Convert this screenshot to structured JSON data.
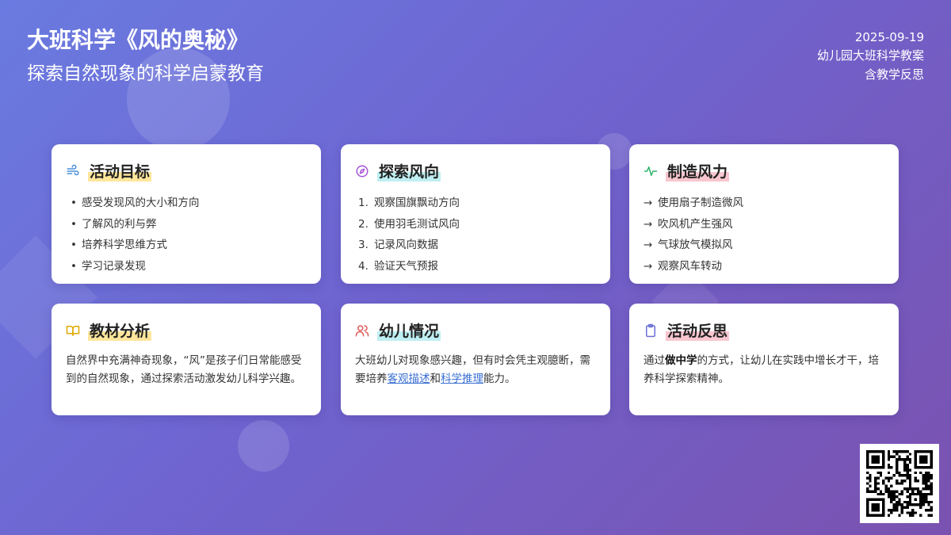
{
  "header": {
    "title": "大班科学《风的奥秘》",
    "subtitle": "探索自然现象的科学启蒙教育"
  },
  "meta": {
    "date": "2025-09-19",
    "type": "幼儿园大班科学教案",
    "note": "含教学反思"
  },
  "cards": {
    "goals": {
      "title": "活动目标",
      "icon": "wind-icon",
      "items": [
        "感受发现风的大小和方向",
        "了解风的利与弊",
        "培养科学思维方式",
        "学习记录发现"
      ]
    },
    "direction": {
      "title": "探索风向",
      "icon": "compass-icon",
      "items": [
        {
          "num": "1.",
          "text": "观察国旗飘动方向"
        },
        {
          "num": "2.",
          "text": "使用羽毛测试风向"
        },
        {
          "num": "3.",
          "text": "记录风向数据"
        },
        {
          "num": "4.",
          "text": "验证天气预报"
        }
      ]
    },
    "power": {
      "title": "制造风力",
      "icon": "activity-icon",
      "arrow": "→",
      "items": [
        "使用扇子制造微风",
        "吹风机产生强风",
        "气球放气模拟风",
        "观察风车转动"
      ]
    },
    "material": {
      "title": "教材分析",
      "icon": "book-icon",
      "text": "自然界中充满神奇现象，“风”是孩子们日常能感受到的自然现象，通过探索活动激发幼儿科学兴趣。"
    },
    "children": {
      "title": "幼儿情况",
      "icon": "users-icon",
      "text_a": "大班幼儿对现象感兴趣，但有时会凭主观臆断，需要培养",
      "link_a": "客观描述",
      "text_b": "和",
      "link_b": "科学推理",
      "text_c": "能力。"
    },
    "reflection": {
      "title": "活动反思",
      "icon": "clipboard-icon",
      "text_a": "通过",
      "bold": "做中学",
      "text_b": "的方式，让幼儿在实践中增长才干，培养科学探索精神。"
    }
  },
  "colors": {
    "wind_icon": "#4a8fd9",
    "compass_icon": "#a655d6",
    "activity_icon": "#2fb36b",
    "book_icon": "#e0a800",
    "users_icon": "#e05a5a",
    "clipboard_icon": "#6b6fd6"
  }
}
